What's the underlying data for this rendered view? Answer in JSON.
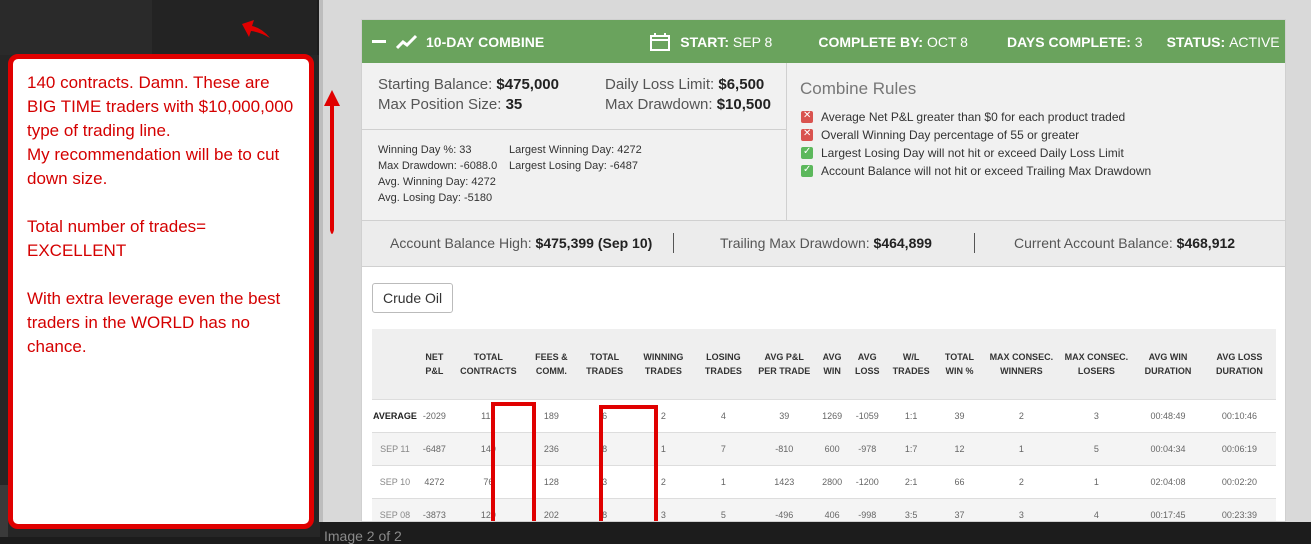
{
  "note": {
    "para1": "140  contracts. Damn. These are BIG TIME traders with $10,000,000 type of trading line.\nMy recommendation will be to cut down size.",
    "para2": "Total number of trades= EXCELLENT",
    "para3": "With extra leverage even the best traders in the WORLD has no chance."
  },
  "caption": "Image 2 of 2",
  "header": {
    "title": "10-DAY COMBINE",
    "start_label": "START:",
    "start_value": "SEP 8",
    "complete_label": "COMPLETE BY:",
    "complete_value": "OCT 8",
    "days_label": "DAYS COMPLETE:",
    "days_value": "3",
    "status_label": "STATUS:",
    "status_value": "ACTIVE"
  },
  "balances": {
    "starting_label": "Starting Balance:",
    "starting_value": "$475,000",
    "max_pos_label": "Max Position Size:",
    "max_pos_value": "35",
    "daily_loss_label": "Daily Loss Limit:",
    "daily_loss_value": "$6,500",
    "max_dd_label": "Max Drawdown:",
    "max_dd_value": "$10,500"
  },
  "stats": {
    "winning_day_pct": "Winning Day %: 33",
    "max_drawdown": "Max Drawdown: -6088.0",
    "avg_winning_day": "Avg. Winning Day: 4272",
    "avg_losing_day": "Avg. Losing Day: -5180",
    "largest_winning_day": "Largest Winning Day: 4272",
    "largest_losing_day": "Largest Losing Day: -6487"
  },
  "rules": {
    "title": "Combine Rules",
    "items": [
      {
        "text": "Average Net P&L greater than $0 for each product traded",
        "status": "fail"
      },
      {
        "text": "Overall Winning Day percentage of 55 or greater",
        "status": "fail"
      },
      {
        "text": "Largest Losing Day will not hit or exceed Daily Loss Limit",
        "status": "pass"
      },
      {
        "text": "Account Balance will not hit or exceed Trailing Max Drawdown",
        "status": "pass"
      }
    ]
  },
  "summary": {
    "high_label": "Account Balance High:",
    "high_value": "$475,399 (Sep 10)",
    "trailing_label": "Trailing Max Drawdown:",
    "trailing_value": "$464,899",
    "current_label": "Current Account Balance:",
    "current_value": "$468,912"
  },
  "product_tab": "Crude Oil",
  "table": {
    "headers": [
      "",
      "NET P&L",
      "TOTAL CONTRACTS",
      "FEES & COMM.",
      "TOTAL TRADES",
      "WINNING TRADES",
      "LOSING TRADES",
      "AVG P&L PER TRADE",
      "AVG WIN",
      "AVG LOSS",
      "W/L TRADES",
      "TOTAL WIN %",
      "MAX CONSEC. WINNERS",
      "MAX CONSEC. LOSERS",
      "AVG WIN DURATION",
      "AVG LOSS DURATION"
    ],
    "rows": [
      [
        "AVERAGE",
        "-2029",
        "112",
        "189",
        "6",
        "2",
        "4",
        "39",
        "1269",
        "-1059",
        "1:1",
        "39",
        "2",
        "3",
        "00:48:49",
        "00:10:46"
      ],
      [
        "SEP 11",
        "-6487",
        "140",
        "236",
        "8",
        "1",
        "7",
        "-810",
        "600",
        "-978",
        "1:7",
        "12",
        "1",
        "5",
        "00:04:34",
        "00:06:19"
      ],
      [
        "SEP 10",
        "4272",
        "76",
        "128",
        "3",
        "2",
        "1",
        "1423",
        "2800",
        "-1200",
        "2:1",
        "66",
        "2",
        "1",
        "02:04:08",
        "00:02:20"
      ],
      [
        "SEP 08",
        "-3873",
        "120",
        "202",
        "8",
        "3",
        "5",
        "-496",
        "406",
        "-998",
        "3:5",
        "37",
        "3",
        "4",
        "00:17:45",
        "00:23:39"
      ]
    ]
  },
  "colors": {
    "header_green": "#6aa35d",
    "annotation_red": "#e00000",
    "fail_red": "#d9534f",
    "pass_green": "#5cb85c"
  }
}
